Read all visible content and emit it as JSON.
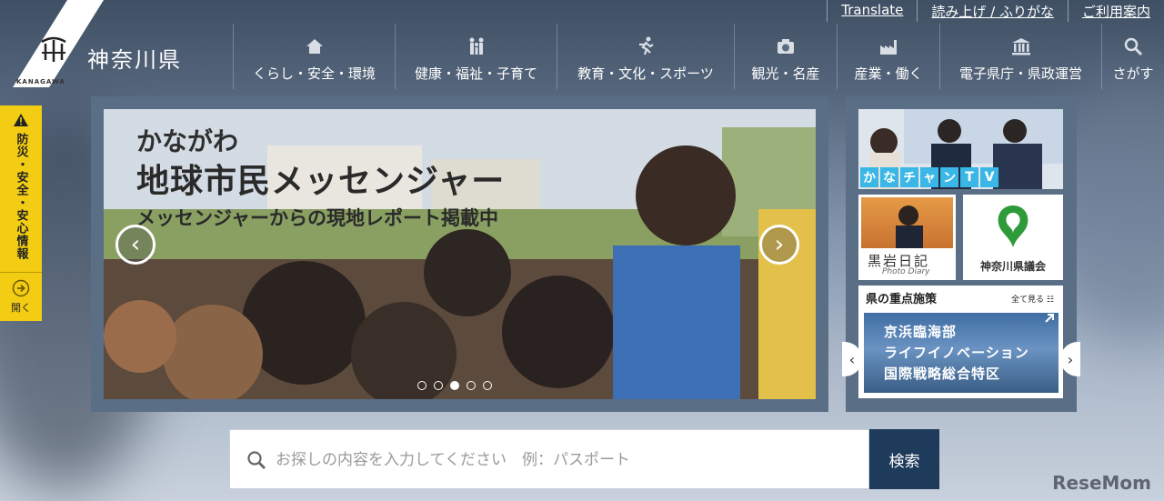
{
  "header": {
    "logo_text": "神奈川県",
    "logo_en": "KANAGAWA"
  },
  "utility": [
    {
      "label": "Translate"
    },
    {
      "label": "読み上げ / ふりがな"
    },
    {
      "label": "ご利用案内"
    }
  ],
  "nav": [
    {
      "label": "くらし・安全・環境",
      "icon": "house-icon"
    },
    {
      "label": "健康・福祉・子育て",
      "icon": "family-icon"
    },
    {
      "label": "教育・文化・スポーツ",
      "icon": "runner-icon"
    },
    {
      "label": "観光・名産",
      "icon": "camera-icon"
    },
    {
      "label": "産業・働く",
      "icon": "factory-icon"
    },
    {
      "label": "電子県庁・県政運営",
      "icon": "government-building-icon"
    },
    {
      "label": "さがす",
      "icon": "search-icon"
    }
  ],
  "disaster": {
    "label": "防災・安全・安心情報",
    "open_label": "開く",
    "accent": "#f3cc14"
  },
  "hero": {
    "title_small": "かながわ",
    "title_large": "地球市民メッセンジャー",
    "subtitle": "メッセンジャーからの現地レポート掲載中",
    "slide_count": 5,
    "active_slide": 3
  },
  "side": {
    "tv_chars": [
      "か",
      "な",
      "チ",
      "ャ",
      "ン",
      "T",
      "V"
    ],
    "diary_title": "黒岩日記",
    "diary_sub": "Photo Diary",
    "gikai_label": "神奈川県議会",
    "policy_head": "県の重点施策",
    "policy_all": "全て見る",
    "policy_lines": [
      "京浜臨海部",
      "ライフイノベーション",
      "国際戦略総合特区"
    ]
  },
  "search": {
    "placeholder": "お探しの内容を入力してください　例：パスポート",
    "button": "検索",
    "button_color": "#1f3b5c"
  },
  "watermark": "ReseMom"
}
